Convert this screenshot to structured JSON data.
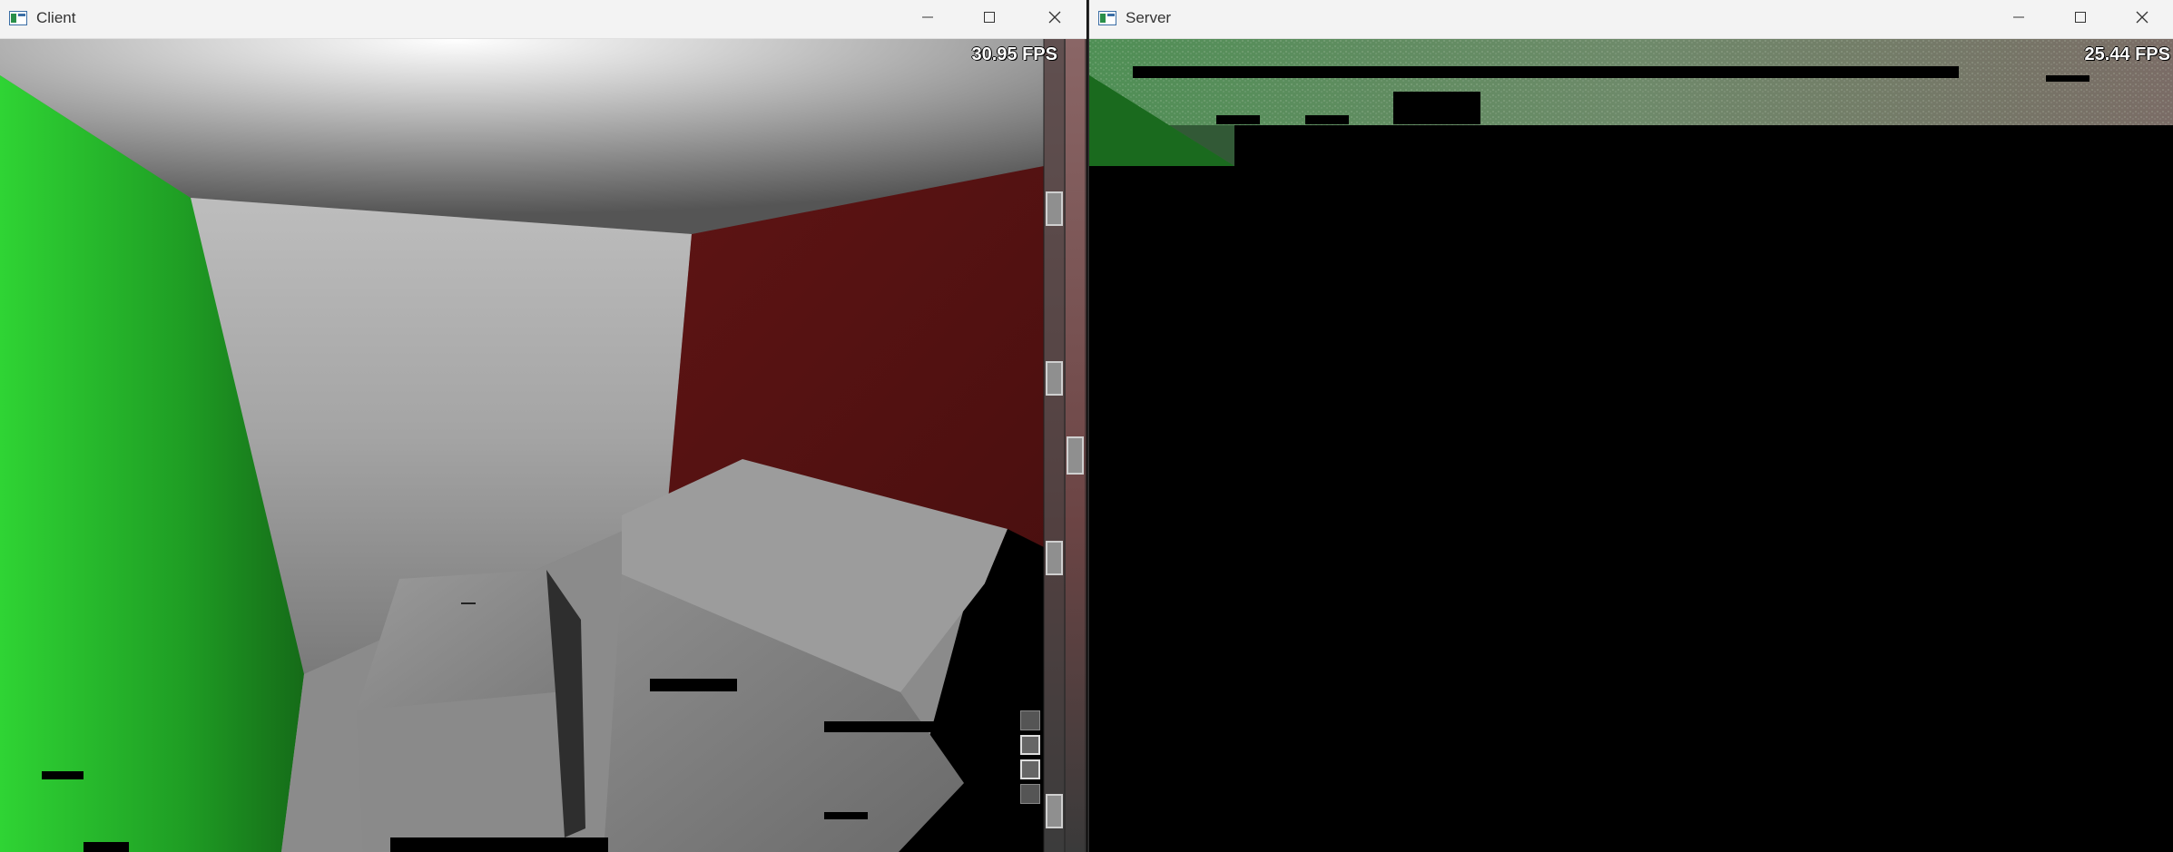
{
  "client": {
    "title": "Client",
    "fps": "30.95 FPS",
    "icon": "app-window-icon"
  },
  "server": {
    "title": "Server",
    "fps": "25.44 FPS",
    "icon": "app-window-icon"
  },
  "window_controls": {
    "minimize_icon": "minimize-icon",
    "maximize_icon": "maximize-icon",
    "close_icon": "close-icon"
  },
  "colors": {
    "titlebar": "#f3f3f3",
    "green_wall": "#2bbf2f",
    "red_wall": "#5a1414",
    "floor_gray": "#8a8a8a"
  }
}
